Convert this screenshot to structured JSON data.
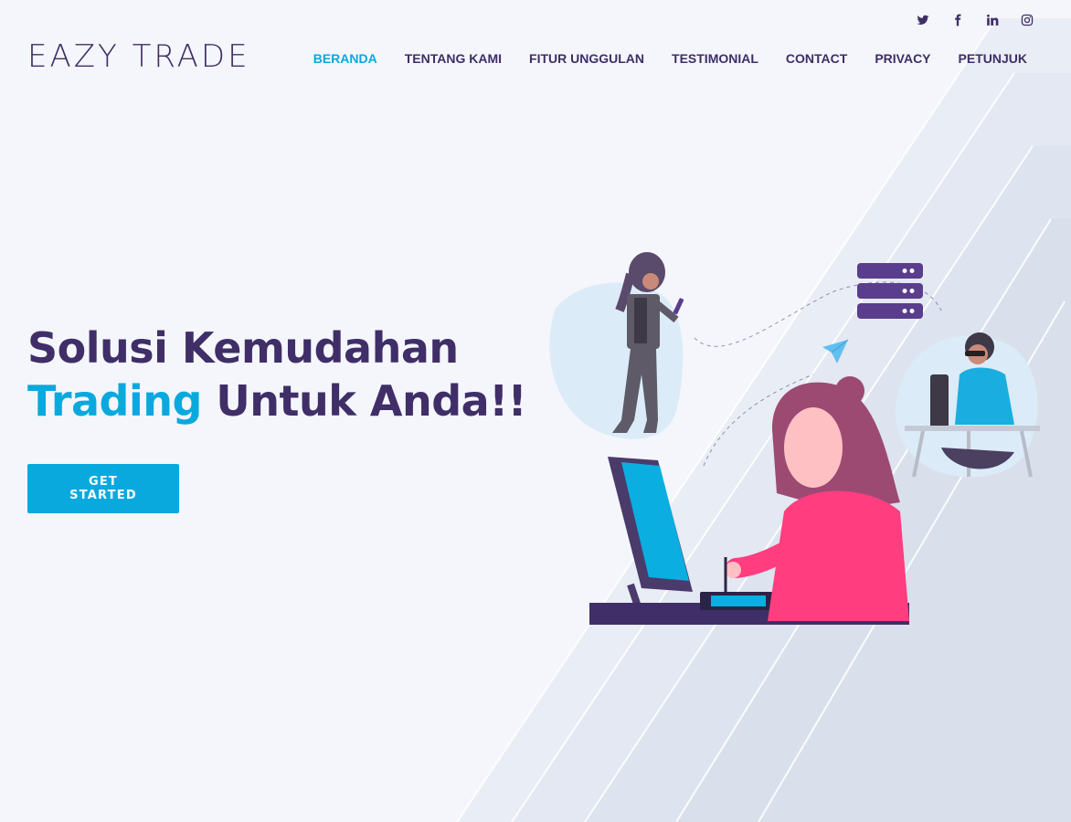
{
  "brand": {
    "logo": "EAZY TRADE"
  },
  "social": [
    "twitter-icon",
    "facebook-icon",
    "linkedin-icon",
    "instagram-icon"
  ],
  "nav": {
    "items": [
      "BERANDA",
      "TENTANG KAMI",
      "FITUR UNGGULAN",
      "TESTIMONIAL",
      "CONTACT",
      "PRIVACY",
      "PETUNJUK"
    ],
    "active": "BERANDA"
  },
  "hero": {
    "line1": "Solusi Kemudahan",
    "line2_accent": "Trading",
    "line2_rest": " Untuk Anda!!",
    "cta_label": "GET STARTED"
  },
  "colors": {
    "primary": "#3f2e67",
    "accent": "#09a9de",
    "background": "#f4f6fb",
    "pink": "#ff3d7f",
    "hair": "#9c4a72"
  }
}
